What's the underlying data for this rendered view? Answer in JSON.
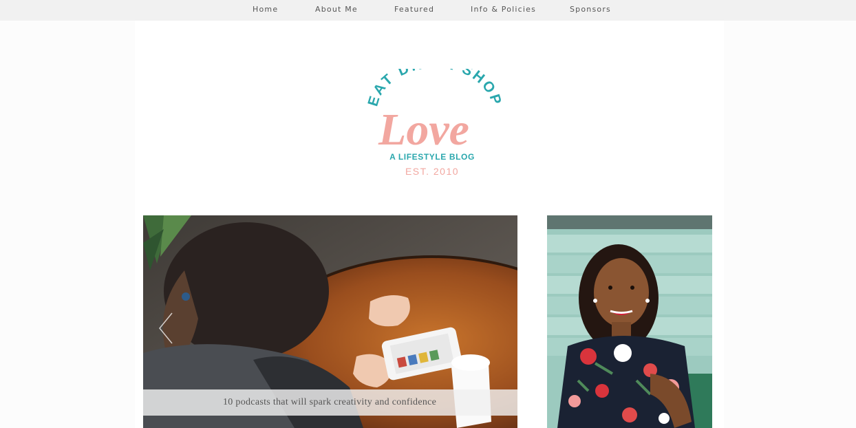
{
  "nav": {
    "items": [
      {
        "label": "Home"
      },
      {
        "label": "About Me"
      },
      {
        "label": "Featured"
      },
      {
        "label": "Info & Policies"
      },
      {
        "label": "Sponsors"
      }
    ]
  },
  "logo": {
    "arc_text": "EAT DRINK SHOP",
    "script_text": "Love",
    "tagline": "A LIFESTYLE BLOG",
    "established": "EST. 2010",
    "colors": {
      "teal": "#2aa7ad",
      "pink": "#f2a7a0"
    }
  },
  "slider": {
    "caption": "10 podcasts that will spark creativity and confidence",
    "prev_icon": "chevron-left-icon"
  },
  "sidebar": {
    "photo_icon": "profile-photo"
  }
}
